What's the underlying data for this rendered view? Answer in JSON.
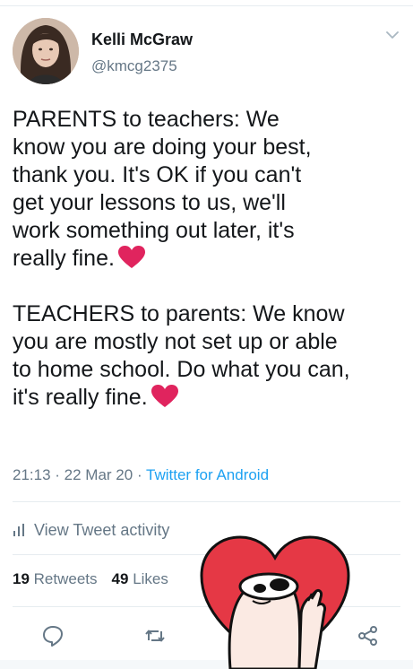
{
  "author": {
    "name": "Kelli McGraw",
    "handle": "@kmcg2375"
  },
  "tweet": {
    "text": "PARENTS to teachers: We\nknow you are doing your best,\nthank you. It's OK if you can't\nget your lessons to us, we'll\nwork something out later, it's\nreally fine.",
    "text2": "TEACHERS to parents: We know\nyou are mostly not set up or able\nto home school. Do what you can,\nit's really fine.",
    "time": "21:13",
    "date": "22 Mar 20",
    "source": "Twitter for Android"
  },
  "activity_label": "View Tweet activity",
  "stats": {
    "retweets_count": "19",
    "retweets_label": "Retweets",
    "likes_count": "49",
    "likes_label": "Likes"
  },
  "icons": [
    "caret-down-icon",
    "heart-emoji-icon",
    "bar-chart-icon",
    "reply-icon",
    "retweet-icon",
    "share-icon",
    "heart-sticker"
  ],
  "colors": {
    "accent": "#1da1f2",
    "secondary_text": "#657786",
    "heart": "#e0245e",
    "sticker_heart": "#e53845"
  }
}
